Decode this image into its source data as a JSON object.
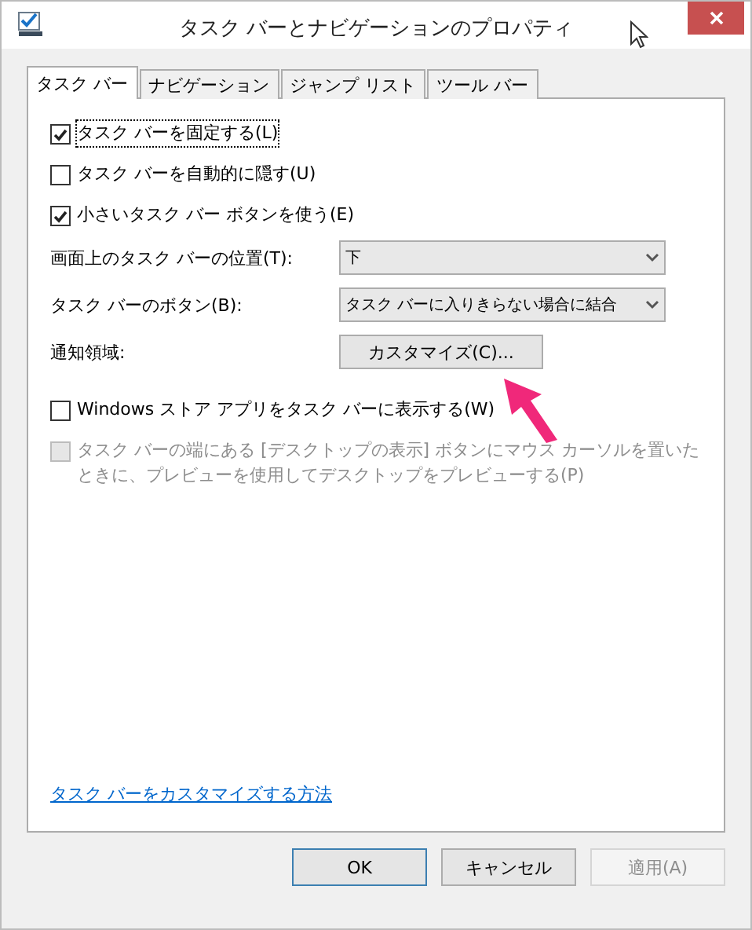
{
  "window": {
    "title": "タスク バーとナビゲーションのプロパティ"
  },
  "tabs": [
    {
      "label": "タスク バー",
      "selected": true
    },
    {
      "label": "ナビゲーション",
      "selected": false
    },
    {
      "label": "ジャンプ リスト",
      "selected": false
    },
    {
      "label": "ツール バー",
      "selected": false
    }
  ],
  "options": [
    {
      "kind": "checkbox",
      "label": "タスク バーを固定する(L)",
      "checked": true,
      "focused": true
    },
    {
      "kind": "checkbox",
      "label": "タスク バーを自動的に隠す(U)",
      "checked": false,
      "focused": false
    },
    {
      "kind": "checkbox",
      "label": "小さいタスク バー ボタンを使う(E)",
      "checked": true,
      "focused": false
    },
    {
      "kind": "select",
      "label": "画面上のタスク バーの位置(T):",
      "value": "下"
    },
    {
      "kind": "select",
      "label": "タスク バーのボタン(B):",
      "value": "タスク バーに入りきらない場合に結合"
    },
    {
      "kind": "button",
      "label": "通知領域:",
      "value": "カスタマイズ(C)..."
    },
    {
      "kind": "checkbox",
      "label": "Windows ストア アプリをタスク バーに表示する(W)",
      "checked": false,
      "focused": false
    },
    {
      "kind": "checkbox",
      "label": "タスク バーの端にある [デスクトップの表示] ボタンにマウス カーソルを置いたときに、プレビューを使用してデスクトップをプレビューする(P)",
      "checked": false,
      "disabled": true,
      "focused": false
    }
  ],
  "help_link": "タスク バーをカスタマイズする方法",
  "buttons": [
    {
      "label": "OK",
      "default": true,
      "disabled": false
    },
    {
      "label": "キャンセル",
      "default": false,
      "disabled": false
    },
    {
      "label": "適用(A)",
      "default": false,
      "disabled": true
    }
  ]
}
